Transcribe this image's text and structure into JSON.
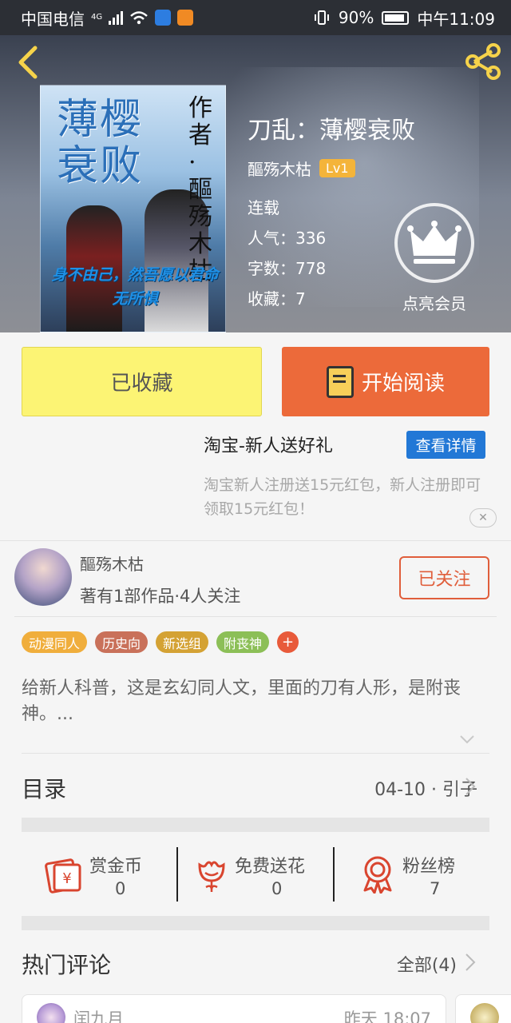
{
  "status_bar": {
    "carrier": "中国电信",
    "network": "4G",
    "battery": "90%",
    "time": "中午11:09"
  },
  "book": {
    "title": "刀乱：薄樱衰败",
    "author": "醧殇木枯",
    "level": "Lv1",
    "status": "连载",
    "popularity": "人气：336",
    "word_count": "字数：778",
    "favorites": "收藏：7",
    "cover_title": "薄樱衰败",
    "cover_author": "作者·醧殇木枯",
    "cover_slogan": "身不由己，然吾愿以君命 无所惧"
  },
  "vip": {
    "label": "点亮会员"
  },
  "actions": {
    "collected_label": "已收藏",
    "read_label": "开始阅读"
  },
  "ad": {
    "title": "淘宝-新人送好礼",
    "button": "查看详情",
    "desc": "淘宝新人注册送15元红包，新人注册即可领取15元红包！"
  },
  "author": {
    "name": "醧殇木枯",
    "stats": "著有1部作品·4人关注",
    "follow_label": "已关注"
  },
  "tags": [
    {
      "label": "动漫同人",
      "color": "#f0ae3c"
    },
    {
      "label": "历史向",
      "color": "#c9715a"
    },
    {
      "label": "新选组",
      "color": "#d4a234"
    },
    {
      "label": "附丧神",
      "color": "#8cbf57"
    }
  ],
  "tag_plus": "+",
  "description": "给新人科普，这是玄幻同人文，里面的刀有人形，是附丧神。...",
  "catalog": {
    "title": "目录",
    "latest": "04-10 · 引子"
  },
  "rewards": [
    {
      "label": "赏金币",
      "count": "0",
      "icon": "coin-envelope-icon"
    },
    {
      "label": "免费送花",
      "count": "0",
      "icon": "flower-icon"
    },
    {
      "label": "粉丝榜",
      "count": "7",
      "icon": "ribbon-medal-icon"
    }
  ],
  "hot_comments": {
    "title": "热门评论",
    "all_label": "全部(4)",
    "first_name": "闰九月",
    "first_time": "昨天 18:07"
  },
  "colors": {
    "accent": "#ec6a3a",
    "collected": "#fcf474",
    "ad_button": "#2278d6"
  }
}
